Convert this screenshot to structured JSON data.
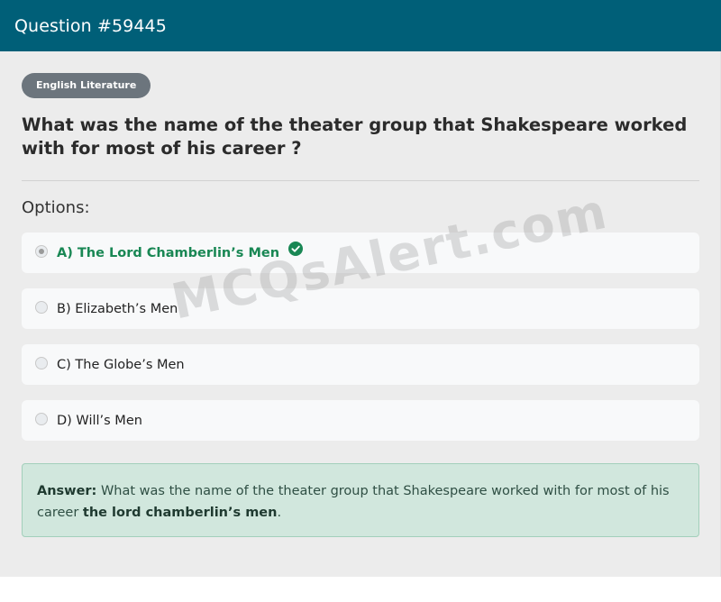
{
  "header": {
    "title": "Question #59445",
    "background": "#005f78"
  },
  "category": {
    "label": "English Literature"
  },
  "question": {
    "text": "What was the name of the theater group that Shakespeare worked with for most of his career ?"
  },
  "options_label": "Options:",
  "options": [
    {
      "label": "A) The Lord Chamberlin’s Men",
      "selected": true,
      "correct": true
    },
    {
      "label": "B) Elizabeth’s Men",
      "selected": false,
      "correct": false
    },
    {
      "label": "C) The Globe’s Men",
      "selected": false,
      "correct": false
    },
    {
      "label": "D) Will’s Men",
      "selected": false,
      "correct": false
    }
  ],
  "answer": {
    "prefix": "Answer:",
    "text": "What was the name of the theater group that Shakespeare worked with for most of his career",
    "value": "the lord chamberlin’s men",
    "suffix": "."
  },
  "watermark": "MCQsAlert.com",
  "colors": {
    "correct": "#198754",
    "answer_bg": "#d1e7dd",
    "tag_bg": "#6c757d"
  },
  "icons": {
    "correct_indicator": "check-circle-icon"
  }
}
